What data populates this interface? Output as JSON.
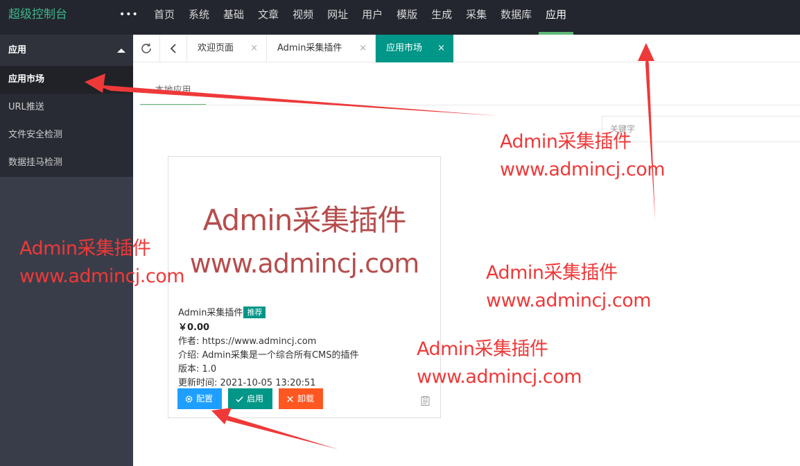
{
  "header": {
    "brand": "超级控制台",
    "more_icon": "ellipsis-icon",
    "nav": [
      {
        "label": "首页",
        "active": false
      },
      {
        "label": "系统",
        "active": false
      },
      {
        "label": "基础",
        "active": false
      },
      {
        "label": "文章",
        "active": false
      },
      {
        "label": "视频",
        "active": false
      },
      {
        "label": "网址",
        "active": false
      },
      {
        "label": "用户",
        "active": false
      },
      {
        "label": "模版",
        "active": false
      },
      {
        "label": "生成",
        "active": false
      },
      {
        "label": "采集",
        "active": false
      },
      {
        "label": "数据库",
        "active": false
      },
      {
        "label": "应用",
        "active": true
      }
    ]
  },
  "sidebar": {
    "group_label": "应用",
    "items": [
      {
        "label": "应用市场",
        "active": true
      },
      {
        "label": "URL推送",
        "active": false
      },
      {
        "label": "文件安全检测",
        "active": false
      },
      {
        "label": "数据挂马检测",
        "active": false
      }
    ]
  },
  "tabs": {
    "refresh_icon": "refresh-icon",
    "back_icon": "chevron-left-icon",
    "items": [
      {
        "label": "欢迎页面",
        "active": false,
        "close": "×"
      },
      {
        "label": "Admin采集插件",
        "active": false,
        "close": "×"
      },
      {
        "label": "应用市场",
        "active": true,
        "close": "×"
      }
    ]
  },
  "content": {
    "inner_tab": "本地应用",
    "search_placeholder": "关键字",
    "card": {
      "image_line1": "Admin采集插件",
      "image_line2": "www.admincj.com",
      "title": "Admin采集插件",
      "badge": "推荐",
      "price": "￥0.00",
      "author": "作者: https://www.admincj.com",
      "intro": "介绍: Admin采集是一个综合所有CMS的插件",
      "version": "版本: 1.0",
      "updated": "更新时间: 2021-10-05 13:20:51",
      "buttons": {
        "config": "配置",
        "enable": "启用",
        "uninstall": "卸载"
      }
    }
  },
  "watermarks": [
    {
      "line1": "Admin采集插件",
      "line2": "www.admincj.com"
    },
    {
      "line1": "Admin采集插件",
      "line2": "www.admincj.com"
    },
    {
      "line1": "Admin采集插件",
      "line2": "www.admincj.com"
    },
    {
      "line1": "Admin采集插件",
      "line2": "www.admincj.com"
    }
  ],
  "colors": {
    "accent": "#009688",
    "brand_text": "#3db58a",
    "nav_active_bar": "#5fb878",
    "annotation": "#ee3939",
    "config_button": "#1e9fff",
    "uninstall_button": "#ff5722"
  }
}
